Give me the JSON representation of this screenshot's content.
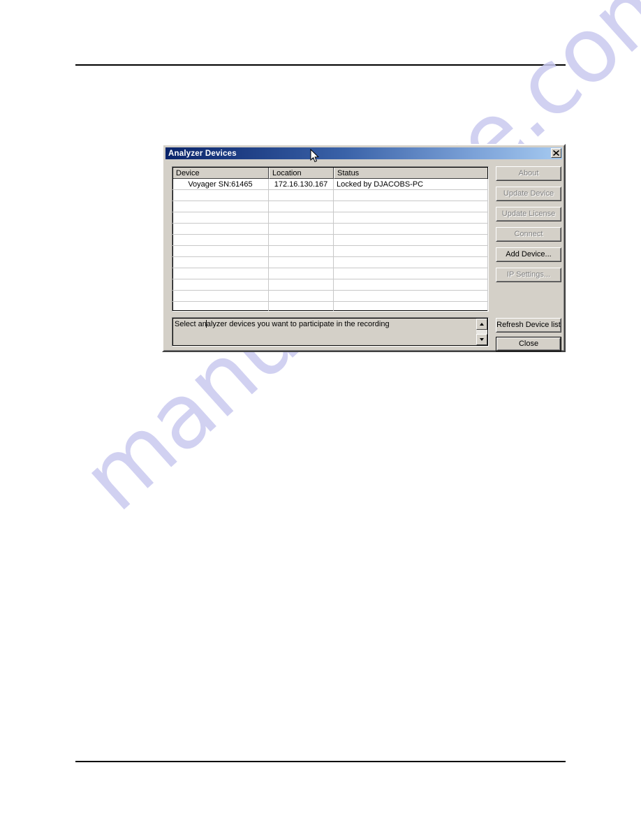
{
  "page": {
    "watermark": "manualshive.com"
  },
  "dialog": {
    "title": "Analyzer Devices",
    "close_icon": "close-icon",
    "list": {
      "columns": [
        "Device",
        "Location",
        "Status"
      ],
      "rows": [
        {
          "device": "Voyager SN:61465",
          "location": "172.16.130.167",
          "status": "Locked by DJACOBS-PC"
        },
        {
          "device": "",
          "location": "",
          "status": ""
        },
        {
          "device": "",
          "location": "",
          "status": ""
        },
        {
          "device": "",
          "location": "",
          "status": ""
        },
        {
          "device": "",
          "location": "",
          "status": ""
        },
        {
          "device": "",
          "location": "",
          "status": ""
        },
        {
          "device": "",
          "location": "",
          "status": ""
        },
        {
          "device": "",
          "location": "",
          "status": ""
        },
        {
          "device": "",
          "location": "",
          "status": ""
        },
        {
          "device": "",
          "location": "",
          "status": ""
        },
        {
          "device": "",
          "location": "",
          "status": ""
        },
        {
          "device": "",
          "location": "",
          "status": ""
        }
      ]
    },
    "status": {
      "text_before_caret": "Select an",
      "text_after_caret": "alyzer devices you want to participate in the recording",
      "full_text": "Select analyzer devices you want to participate in the recording",
      "scroll_up_icon": "scroll-up-arrow-icon",
      "scroll_down_icon": "scroll-down-arrow-icon"
    },
    "buttons": [
      {
        "label": "About",
        "enabled": false
      },
      {
        "label": "Update Device",
        "enabled": false
      },
      {
        "label": "Update License",
        "enabled": false
      },
      {
        "label": "Connect",
        "enabled": false
      },
      {
        "label": "Add Device...",
        "enabled": true
      },
      {
        "label": "IP Settings...",
        "enabled": false
      },
      {
        "label": "Refresh Device list",
        "enabled": true
      },
      {
        "label": "Close",
        "enabled": true
      }
    ]
  },
  "colors": {
    "title_gradient_start": "#0a246a",
    "title_gradient_end": "#a6caf0",
    "dialog_face": "#d4d0c8",
    "disabled_text": "#808080",
    "watermark": "#c9c9ef"
  }
}
